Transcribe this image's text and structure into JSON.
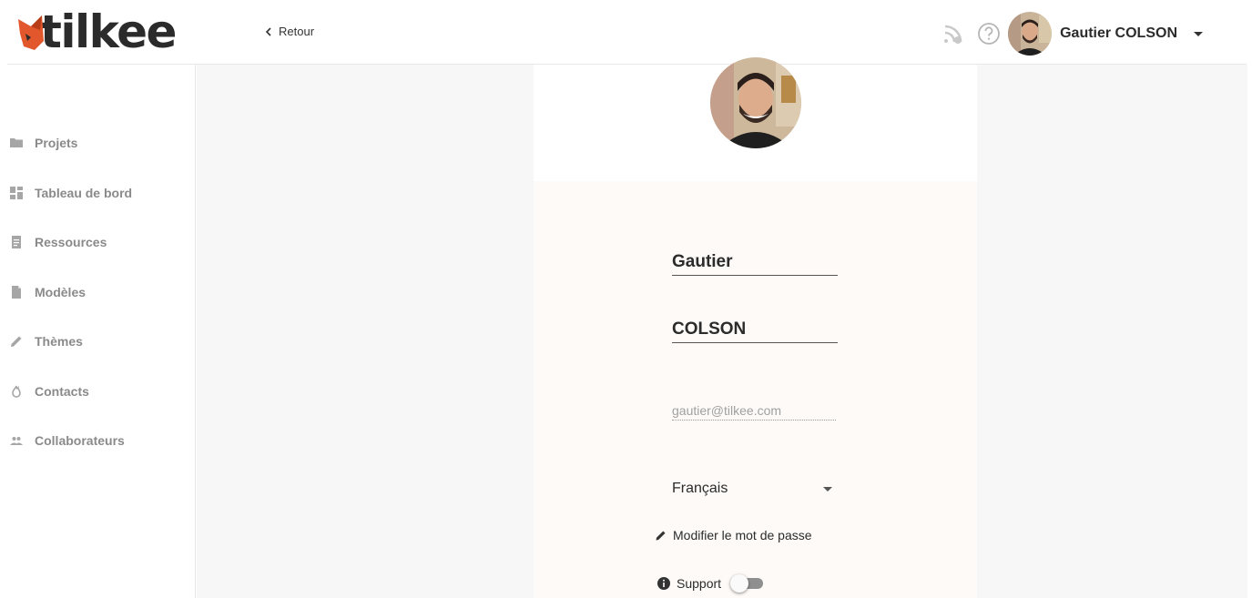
{
  "brand": {
    "name": "tilkee",
    "accent": "#e2572c"
  },
  "header": {
    "back_label": "Retour",
    "user_name": "Gautier COLSON",
    "icons": [
      "rss-feed-icon",
      "help-icon",
      "user-avatar",
      "chevron-down-icon"
    ]
  },
  "sidebar": {
    "items": [
      {
        "label": "Projets",
        "icon": "folder-icon"
      },
      {
        "label": "Tableau de bord",
        "icon": "dashboard-icon"
      },
      {
        "label": "Ressources",
        "icon": "document-icon"
      },
      {
        "label": "Modèles",
        "icon": "file-icon"
      },
      {
        "label": "Thèmes",
        "icon": "pencil-icon"
      },
      {
        "label": "Contacts",
        "icon": "fire-icon"
      },
      {
        "label": "Collaborateurs",
        "icon": "people-icon"
      }
    ]
  },
  "profile": {
    "first_name": "Gautier",
    "last_name": "COLSON",
    "email": "gautier@tilkee.com",
    "language": "Français",
    "change_password_label": "Modifier le mot de passe",
    "support_label": "Support",
    "support_enabled": false
  }
}
